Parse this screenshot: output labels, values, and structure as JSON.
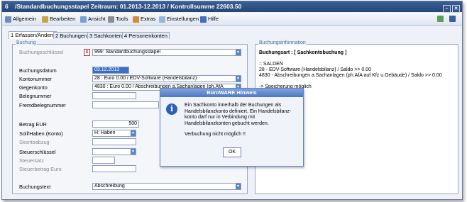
{
  "window": {
    "number": "6",
    "title": "/Standardbuchungsstapel Zeitraum: 01.2013-12.2013 / Kontrollsumme 22603.50",
    "min_symbol": "–",
    "close_symbol": "✕"
  },
  "toolbar": {
    "items": [
      {
        "label": "Allgemein",
        "icon": "settings-icon"
      },
      {
        "label": "Bearbeiten",
        "icon": "edit-icon"
      },
      {
        "label": "Ansicht",
        "icon": "view-icon"
      },
      {
        "label": "Tools",
        "icon": "tools-icon"
      },
      {
        "label": "Extras",
        "icon": "extras-icon"
      },
      {
        "label": "Einstellungen",
        "icon": "settings-list-icon"
      },
      {
        "label": "Hilfe",
        "icon": "help-icon"
      }
    ]
  },
  "tabs": [
    {
      "label": "1 Erfassen/Ändern"
    },
    {
      "label": "2 Buchungen"
    },
    {
      "label": "3 Sachkonten"
    },
    {
      "label": "4 Personenkonten"
    }
  ],
  "buchung": {
    "legend": "Buchung",
    "buchungsschluessel_label": "Buchungsschlüssel",
    "buchungsschluessel_value": "999: Standardbuchungsstapel",
    "buchungsdatum_label": "Buchungsdatum",
    "buchungsdatum_value": "03.12.2013",
    "kontonummer_label": "Kontonummer",
    "kontonummer_value": "28 : Euro 0.00 / EDV-Software (Handelsbilanz)",
    "gegenkonto_label": "Gegenkonto",
    "gegenkonto_value": "4830 : Euro 0.00 / Abschreibungen a.Sachanlagen (ph.AfA",
    "belegnummer_label": "Belegnummer",
    "fremdbelegnummer_label": "Fremdbelegnummer",
    "betrag_label": "Betrag EUR",
    "betrag_value": "500",
    "sollhaben_label": "Soll/Haben (Konto)",
    "sollhaben_value": "H: Haben",
    "skontoabzug_label": "Skontoabzug",
    "steuerschluessel_label": "Steuerschlüssel",
    "steuersatz_label": "Steuersatz",
    "steuerbetrag_label": "Steuerbetrag Euro",
    "buchungstext_label": "Buchungstext",
    "buchungstext_value": "Abschreibung"
  },
  "info": {
    "legend": "Buchungsinformation",
    "lines": [
      "Buchungsart : [ Sachkontobuchung ]",
      ":: SALDEN",
      "28 - EDV-Software (Handelsbilanz) / Saldo >> 0.00",
      "4830 - Abschreibungen a.Sachanlagen (ph.AfA auf Kfz u.Gebäude) / Saldo >> 0.00",
      "-> Speicherung möglich"
    ]
  },
  "dialog": {
    "title": "BüroWARE Hinweis",
    "message": "Ein Sachkonto innerhalb der Buchungen als Handelsbilanzkonto definiert. Ein Handelsbilanz-konto darf nur in Verbindung mit Handelsbilanzkonten gebucht werden.",
    "message2": "Verbuchung nicht möglich !!",
    "ok_label": "OK"
  }
}
